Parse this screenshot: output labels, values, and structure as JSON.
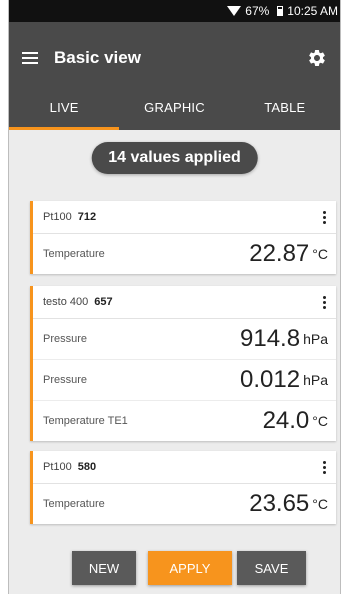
{
  "status_bar": {
    "battery": "67%",
    "time": "10:25 AM"
  },
  "app_bar": {
    "title": "Basic view"
  },
  "tabs": [
    {
      "label": "LIVE"
    },
    {
      "label": "GRAPHIC"
    },
    {
      "label": "TABLE"
    }
  ],
  "applied_badge": "14 values applied",
  "cards": [
    {
      "device": "Pt100",
      "serial": "712",
      "rows": [
        {
          "label": "Temperature",
          "value": "22.87",
          "unit": "°C"
        }
      ]
    },
    {
      "device": "testo 400",
      "serial": "657",
      "rows": [
        {
          "label": "Pressure",
          "value": "914.8",
          "unit": "hPa"
        },
        {
          "label": "Pressure",
          "value": "0.012",
          "unit": "hPa"
        },
        {
          "label": "Temperature TE1",
          "value": "24.0",
          "unit": "°C"
        }
      ]
    },
    {
      "device": "Pt100",
      "serial": "580",
      "rows": [
        {
          "label": "Temperature",
          "value": "23.65",
          "unit": "°C"
        }
      ]
    }
  ],
  "buttons": {
    "new": "NEW",
    "apply": "APPLY",
    "save": "SAVE"
  },
  "colors": {
    "accent": "#f7941d",
    "toolbar": "#4a4a4a"
  }
}
